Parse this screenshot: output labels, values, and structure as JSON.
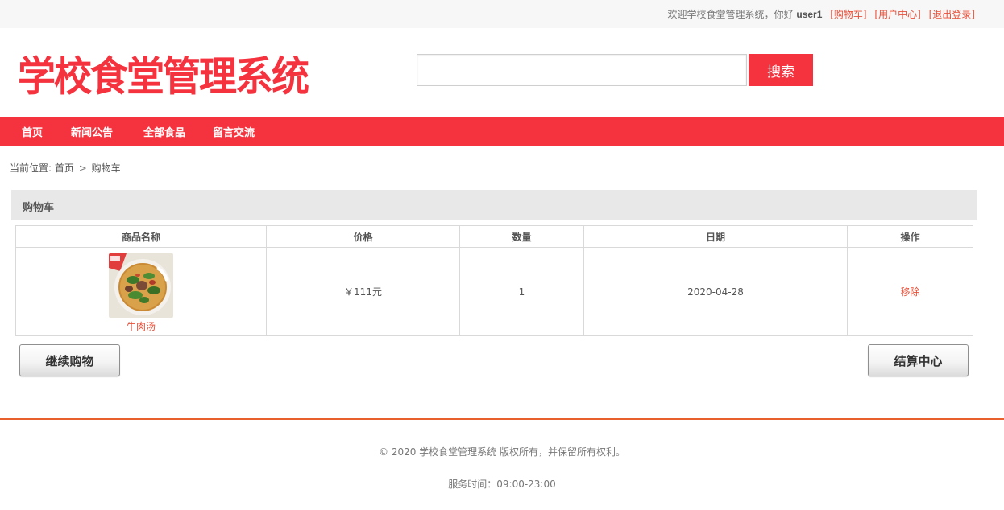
{
  "topbar": {
    "welcome": "欢迎学校食堂管理系统，你好",
    "username": "user1",
    "links": [
      "[购物车]",
      "[用户中心]",
      "[退出登录]"
    ]
  },
  "header": {
    "logo_text": "学校食堂管理系统",
    "search_value": "",
    "search_button": "搜索"
  },
  "nav": {
    "items": [
      "首页",
      "新闻公告",
      "全部食品",
      "留言交流"
    ]
  },
  "breadcrumb": {
    "prefix": "当前位置:",
    "home": "首页",
    "separator": ">",
    "current": "购物车"
  },
  "cart": {
    "title": "购物车",
    "columns": [
      "商品名称",
      "价格",
      "数量",
      "日期",
      "操作"
    ],
    "rows": [
      {
        "name": "牛肉汤",
        "image_icon": "beef-soup-photo",
        "price": "￥111元",
        "quantity": "1",
        "date": "2020-04-28",
        "action": "移除"
      }
    ]
  },
  "buttons": {
    "continue": "继续购物",
    "checkout": "结算中心"
  },
  "footer": {
    "copyright": "© 2020 学校食堂管理系统 版权所有，并保留所有权利。",
    "service_time": "服务时间：09:00-23:00"
  },
  "colors": {
    "brand_red": "#f5333f",
    "link_orange": "#e8503a",
    "footer_line": "#e8602c"
  }
}
